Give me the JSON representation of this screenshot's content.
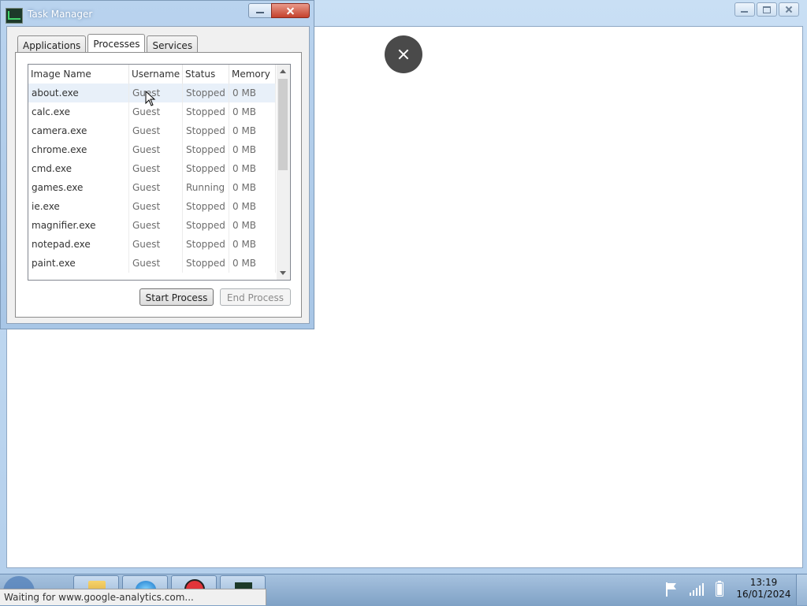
{
  "browser": {
    "status_text": "Waiting for www.google-analytics.com..."
  },
  "task_manager": {
    "title": "Task Manager",
    "tabs": [
      "Applications",
      "Processes",
      "Services"
    ],
    "active_tab": "Processes",
    "columns": [
      "Image Name",
      "Username",
      "Status",
      "Memory"
    ],
    "rows": [
      {
        "name": "about.exe",
        "user": "Guest",
        "status": "Stopped",
        "memory": "0 MB"
      },
      {
        "name": "calc.exe",
        "user": "Guest",
        "status": "Stopped",
        "memory": "0 MB"
      },
      {
        "name": "camera.exe",
        "user": "Guest",
        "status": "Stopped",
        "memory": "0 MB"
      },
      {
        "name": "chrome.exe",
        "user": "Guest",
        "status": "Stopped",
        "memory": "0 MB"
      },
      {
        "name": "cmd.exe",
        "user": "Guest",
        "status": "Stopped",
        "memory": "0 MB"
      },
      {
        "name": "games.exe",
        "user": "Guest",
        "status": "Running",
        "memory": "0 MB"
      },
      {
        "name": "ie.exe",
        "user": "Guest",
        "status": "Stopped",
        "memory": "0 MB"
      },
      {
        "name": "magnifier.exe",
        "user": "Guest",
        "status": "Stopped",
        "memory": "0 MB"
      },
      {
        "name": "notepad.exe",
        "user": "Guest",
        "status": "Stopped",
        "memory": "0 MB"
      },
      {
        "name": "paint.exe",
        "user": "Guest",
        "status": "Stopped",
        "memory": "0 MB"
      }
    ],
    "buttons": {
      "start": "Start Process",
      "end": "End Process"
    }
  },
  "taskbar": {
    "time": "13:19",
    "date": "16/01/2024"
  }
}
